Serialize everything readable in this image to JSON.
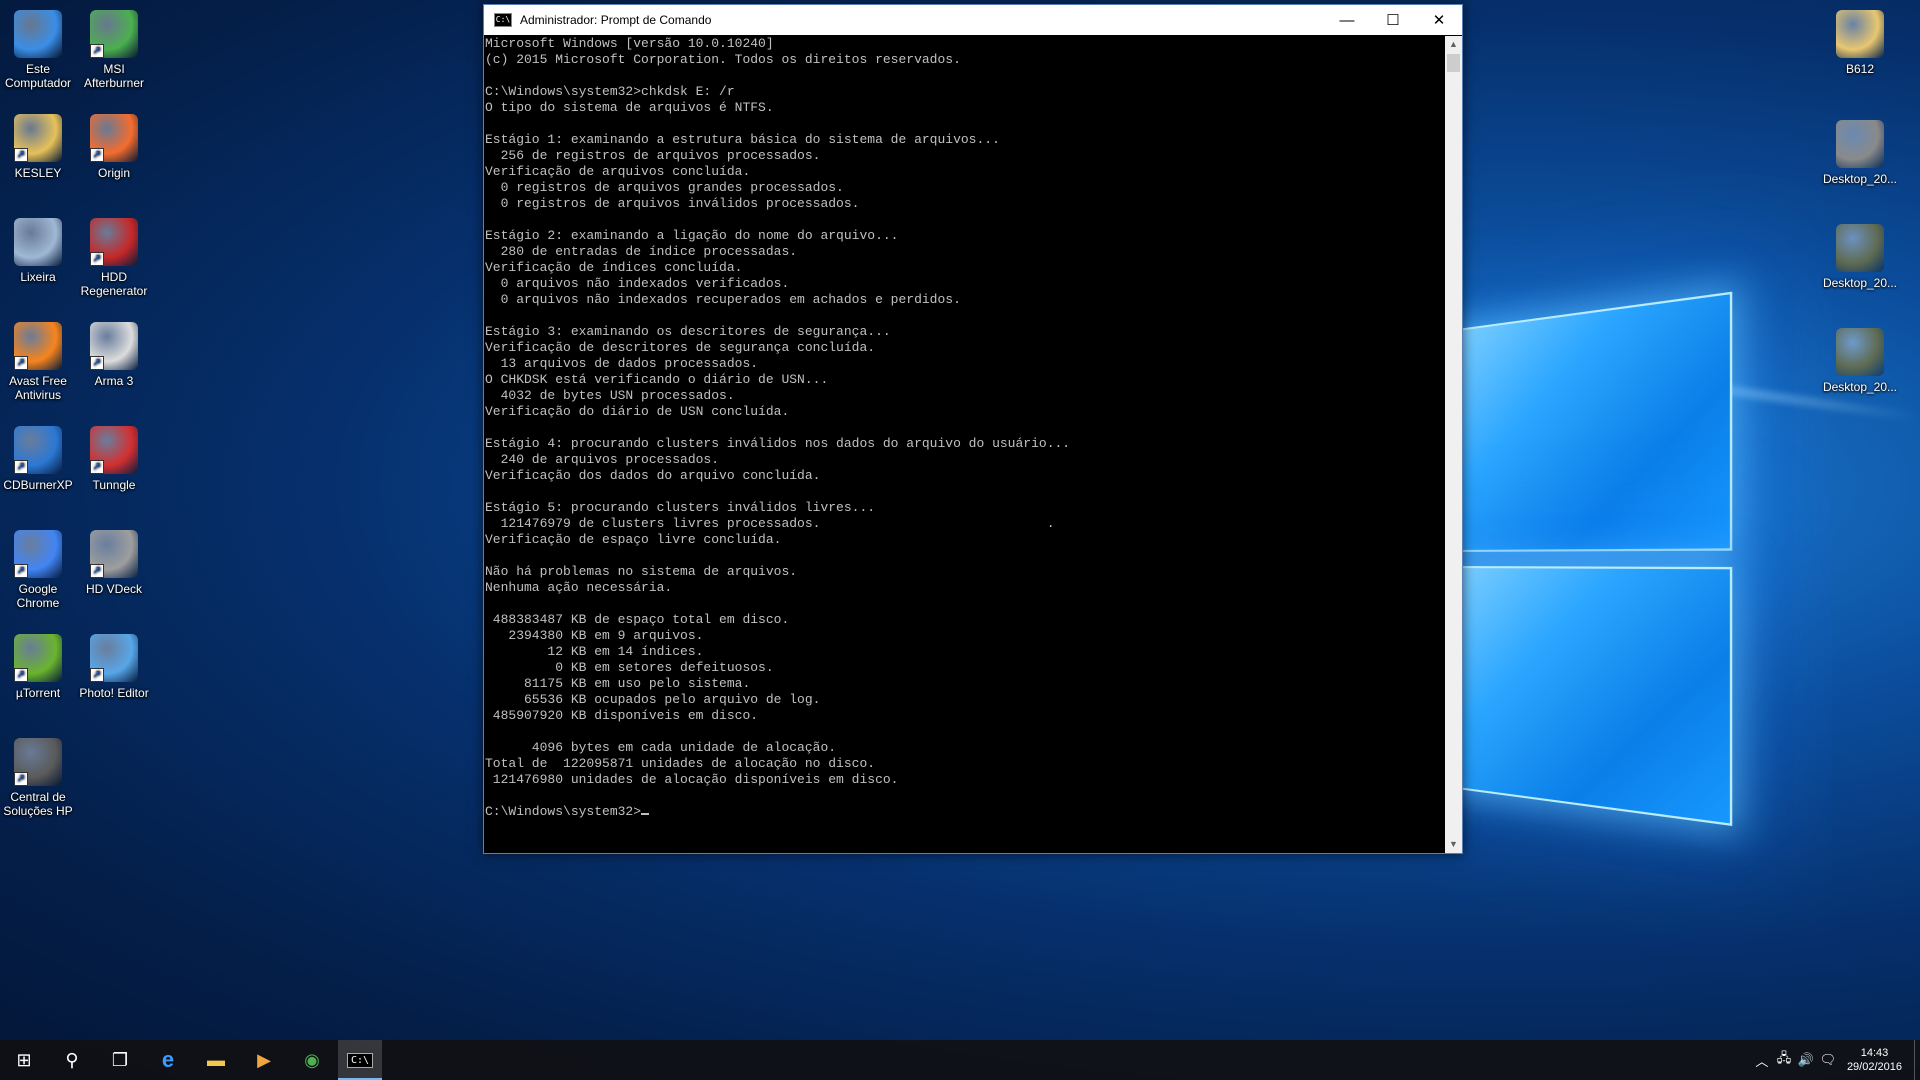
{
  "desktop_icons_left": [
    {
      "label": "Este Computador",
      "icon": "monitor-icon",
      "color": "#3a8ee6"
    },
    {
      "label": "MSI Afterburner",
      "icon": "afterburner-icon",
      "color": "#4caf50"
    },
    {
      "label": "KESLEY",
      "icon": "user-folder-icon",
      "color": "#e6c15a"
    },
    {
      "label": "Origin",
      "icon": "origin-icon",
      "color": "#f56c2d"
    },
    {
      "label": "Lixeira",
      "icon": "recycle-bin-icon",
      "color": "#9fb8d4"
    },
    {
      "label": "HDD Regenerator",
      "icon": "hdd-regenerator-icon",
      "color": "#c62828"
    },
    {
      "label": "Avast Free Antivirus",
      "icon": "avast-icon",
      "color": "#f7841d"
    },
    {
      "label": "Arma 3",
      "icon": "arma3-icon",
      "color": "#dcdcdc"
    },
    {
      "label": "CDBurnerXP",
      "icon": "cdburner-icon",
      "color": "#2c78d4"
    },
    {
      "label": "Tunngle",
      "icon": "tunngle-icon",
      "color": "#d32f2f"
    },
    {
      "label": "Google Chrome",
      "icon": "chrome-icon",
      "color": "#4285f4"
    },
    {
      "label": "HD VDeck",
      "icon": "hdvdeck-icon",
      "color": "#9e9e9e"
    },
    {
      "label": "µTorrent",
      "icon": "utorrent-icon",
      "color": "#6bb42d"
    },
    {
      "label": "Photo! Editor",
      "icon": "photo-editor-icon",
      "color": "#58a6e8"
    },
    {
      "label": "Central de Soluções HP",
      "icon": "hp-icon",
      "color": "#5a5a5a"
    }
  ],
  "desktop_icons_right": [
    {
      "label": "B612",
      "icon": "zip-folder-icon",
      "color": "#e8c770"
    },
    {
      "label": "Desktop_20...",
      "icon": "image-thumbnail-icon",
      "color": "#8a8a8a"
    },
    {
      "label": "Desktop_20...",
      "icon": "image-thumbnail-icon",
      "color": "#5f6b52"
    },
    {
      "label": "Desktop_20...",
      "icon": "image-thumbnail-icon",
      "color": "#5f6b52"
    }
  ],
  "cmd_window": {
    "title": "Administrador: Prompt de Comando",
    "icon_text": "C:\\",
    "minimize": "—",
    "maximize": "☐",
    "close": "✕",
    "lines": [
      "Microsoft Windows [versão 10.0.10240]",
      "(c) 2015 Microsoft Corporation. Todos os direitos reservados.",
      "",
      "C:\\Windows\\system32>chkdsk E: /r",
      "O tipo do sistema de arquivos é NTFS.",
      "",
      "Estágio 1: examinando a estrutura básica do sistema de arquivos...",
      "  256 de registros de arquivos processados.",
      "Verificação de arquivos concluída.",
      "  0 registros de arquivos grandes processados.",
      "  0 registros de arquivos inválidos processados.",
      "",
      "Estágio 2: examinando a ligação do nome do arquivo...",
      "  280 de entradas de índice processadas.",
      "Verificação de índices concluída.",
      "  0 arquivos não indexados verificados.",
      "  0 arquivos não indexados recuperados em achados e perdidos.",
      "",
      "Estágio 3: examinando os descritores de segurança...",
      "Verificação de descritores de segurança concluída.",
      "  13 arquivos de dados processados.",
      "O CHKDSK está verificando o diário de USN...",
      "  4032 de bytes USN processados.",
      "Verificação do diário de USN concluída.",
      "",
      "Estágio 4: procurando clusters inválidos nos dados do arquivo do usuário...",
      "  240 de arquivos processados.",
      "Verificação dos dados do arquivo concluída.",
      "",
      "Estágio 5: procurando clusters inválidos livres...",
      "  121476979 de clusters livres processados.                             .",
      "Verificação de espaço livre concluída.",
      "",
      "Não há problemas no sistema de arquivos.",
      "Nenhuma ação necessária.",
      "",
      " 488383487 KB de espaço total em disco.",
      "   2394380 KB em 9 arquivos.",
      "        12 KB em 14 índices.",
      "         0 KB em setores defeituosos.",
      "     81175 KB em uso pelo sistema.",
      "     65536 KB ocupados pelo arquivo de log.",
      " 485907920 KB disponíveis em disco.",
      "",
      "      4096 bytes em cada unidade de alocação.",
      "Total de  122095871 unidades de alocação no disco.",
      " 121476980 unidades de alocação disponíveis em disco.",
      "",
      "C:\\Windows\\system32>"
    ]
  },
  "taskbar": {
    "items": [
      {
        "name": "start-button",
        "icon": "windows-logo-icon",
        "glyph": "⊞"
      },
      {
        "name": "search-button",
        "icon": "search-icon",
        "glyph": "⚲"
      },
      {
        "name": "task-view-button",
        "icon": "task-view-icon",
        "glyph": "❐"
      },
      {
        "name": "edge-taskbar-button",
        "icon": "edge-icon",
        "glyph": "e"
      },
      {
        "name": "file-explorer-taskbar-button",
        "icon": "folder-icon",
        "glyph": "▬"
      },
      {
        "name": "media-player-taskbar-button",
        "icon": "media-player-icon",
        "glyph": "▶"
      },
      {
        "name": "chrome-taskbar-button",
        "icon": "chrome-icon",
        "glyph": "◉"
      },
      {
        "name": "cmd-taskbar-button",
        "icon": "cmd-icon",
        "glyph": "C:\\",
        "active": true
      }
    ],
    "tray": {
      "chevron": "︿",
      "network": "🖧",
      "volume": "🔊",
      "notifications": "🗨"
    },
    "clock_time": "14:43",
    "clock_date": "29/02/2016"
  }
}
